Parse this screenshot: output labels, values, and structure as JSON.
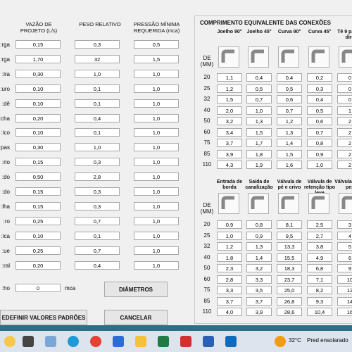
{
  "headers": {
    "flow": "VAZÃO DE PROJETO (L/s)",
    "weight": "PESO RELATIVO",
    "pressure": "PRESSÃO MÍNIMA REQUERIDA (mca)"
  },
  "rows": [
    {
      "label": "rga:",
      "flow": "0,15",
      "weight": "0,3",
      "pressure": "0,5"
    },
    {
      "label": "rga:",
      "flow": "1,70",
      "weight": "32",
      "pressure": "1,5"
    },
    {
      "label": "ira:",
      "flow": "0,30",
      "weight": "1,0",
      "pressure": "1,0"
    },
    {
      "label": "uro:",
      "flow": "0,10",
      "weight": "0,1",
      "pressure": "1,0"
    },
    {
      "label": "dê:",
      "flow": "0,10",
      "weight": "0,1",
      "pressure": "1,0"
    },
    {
      "label": "cha:",
      "flow": "0,20",
      "weight": "0,4",
      "pressure": "1,0"
    },
    {
      "label": "ico:",
      "flow": "0,10",
      "weight": "0,1",
      "pressure": "1,0"
    },
    {
      "label": "pas:",
      "flow": "0,30",
      "weight": "1,0",
      "pressure": "1,0"
    },
    {
      "label": "rio:",
      "flow": "0,15",
      "weight": "0,3",
      "pressure": "1,0"
    },
    {
      "label": "do:",
      "flow": "0,50",
      "weight": "2,8",
      "pressure": "1,0"
    },
    {
      "label": "do:",
      "flow": "0,15",
      "weight": "0,3",
      "pressure": "1,0"
    },
    {
      "label": "lha:",
      "flow": "0,15",
      "weight": "0,3",
      "pressure": "1,0"
    },
    {
      "label": "ro:",
      "flow": "0,25",
      "weight": "0,7",
      "pressure": "1,0"
    },
    {
      "label": "ica:",
      "flow": "0,10",
      "weight": "0,1",
      "pressure": "1,0"
    },
    {
      "label": "ue:",
      "flow": "0,25",
      "weight": "0,7",
      "pressure": "1,0"
    },
    {
      "label": "ral:",
      "flow": "0,20",
      "weight": "0,4",
      "pressure": "1,0"
    }
  ],
  "bottom": {
    "label": "ho:",
    "value": "0",
    "unit": "mca",
    "diametros_button": "DIÂMETROS",
    "reset_button": "EDEFINIR VALORES PADRÕES",
    "cancel_button": "CANCELAR"
  },
  "panel": {
    "title": "COMPRIMENTO EQUIVALENTE DAS CONEXÕES",
    "de_label": "DE\n(MM)",
    "top_headers": [
      "Joelho 90°",
      "Joelho 45°",
      "Curva 90°",
      "Curva 45°",
      "Tê 9 passa dire"
    ],
    "bottom_headers": [
      "Entrada de borda",
      "Saída de canalização",
      "Válvula de pé e crivo",
      "Válvula de retenção tipo leve",
      "Válvula reten pes"
    ],
    "diameters": [
      "20",
      "25",
      "32",
      "40",
      "50",
      "60",
      "75",
      "85",
      "110"
    ],
    "top_values": [
      [
        "1,1",
        "0,4",
        "0,4",
        "0,2",
        "0"
      ],
      [
        "1,2",
        "0,5",
        "0,5",
        "0,3",
        "0"
      ],
      [
        "1,5",
        "0,7",
        "0,6",
        "0,4",
        "0"
      ],
      [
        "2,0",
        "1,0",
        "0,7",
        "0,5",
        "1"
      ],
      [
        "3,2",
        "1,3",
        "1,2",
        "0,6",
        "2"
      ],
      [
        "3,4",
        "1,5",
        "1,3",
        "0,7",
        "2"
      ],
      [
        "3,7",
        "1,7",
        "1,4",
        "0,8",
        "2"
      ],
      [
        "3,9",
        "1,8",
        "1,5",
        "0,9",
        "2"
      ],
      [
        "4,3",
        "1,9",
        "1,6",
        "1,0",
        "2"
      ]
    ],
    "bottom_values": [
      [
        "0,9",
        "0,8",
        "8,1",
        "2,5",
        "3"
      ],
      [
        "1,0",
        "0,9",
        "9,5",
        "2,7",
        "4"
      ],
      [
        "1,2",
        "1,3",
        "13,3",
        "3,8",
        "5"
      ],
      [
        "1,8",
        "1,4",
        "15,5",
        "4,9",
        "6"
      ],
      [
        "2,3",
        "3,2",
        "18,3",
        "6,8",
        "9"
      ],
      [
        "2,8",
        "3,3",
        "23,7",
        "7,1",
        "10"
      ],
      [
        "3,3",
        "3,5",
        "25,0",
        "8,2",
        "12"
      ],
      [
        "3,7",
        "3,7",
        "26,8",
        "9,3",
        "14"
      ],
      [
        "4,0",
        "3,9",
        "28,6",
        "10,4",
        "16"
      ]
    ]
  },
  "taskbar": {
    "temp": "32°C",
    "weather": "Pred ensolarado"
  }
}
